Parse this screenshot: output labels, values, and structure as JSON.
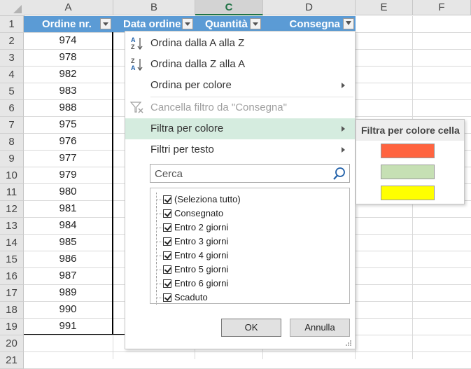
{
  "columns": [
    "A",
    "B",
    "C",
    "D",
    "E",
    "F"
  ],
  "rows": [
    "1",
    "2",
    "3",
    "4",
    "5",
    "6",
    "7",
    "8",
    "9",
    "10",
    "11",
    "12",
    "13",
    "14",
    "15",
    "16",
    "17",
    "18",
    "19",
    "20",
    "21"
  ],
  "table_headers": {
    "a": "Ordine nr.",
    "b": "Data ordine",
    "c": "Quantità",
    "d": "Consegna"
  },
  "order_numbers": [
    "974",
    "978",
    "982",
    "983",
    "988",
    "975",
    "976",
    "977",
    "979",
    "980",
    "981",
    "984",
    "985",
    "986",
    "987",
    "989",
    "990",
    "991"
  ],
  "menu": {
    "sort_az": "Ordina dalla A alla Z",
    "sort_za": "Ordina dalla Z alla A",
    "sort_color": "Ordina per colore",
    "clear_filter": "Cancella filtro da \"Consegna\"",
    "filter_color": "Filtra per colore",
    "text_filters": "Filtri per testo",
    "search_placeholder": "Cerca",
    "ok": "OK",
    "cancel": "Annulla"
  },
  "filter_items": [
    "(Seleziona tutto)",
    "Consegnato",
    "Entro 2 giorni",
    "Entro 3 giorni",
    "Entro 4 giorni",
    "Entro 5 giorni",
    "Entro 6 giorni",
    "Scaduto"
  ],
  "submenu": {
    "title": "Filtra per colore cella",
    "colors": [
      "#ff6440",
      "#c6e0b4",
      "#ffff00"
    ]
  },
  "theme": {
    "header_blue": "#5b9bd5",
    "highlight_green": "#d5ecdf",
    "excel_green": "#217346"
  }
}
